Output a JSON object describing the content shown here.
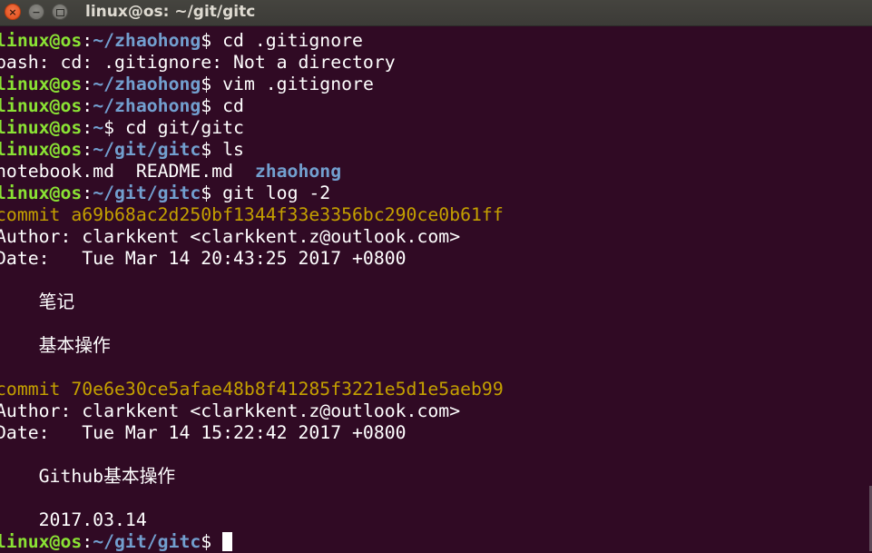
{
  "window": {
    "title": "linux@os: ~/git/gitc",
    "close_icon": "×",
    "minimize_icon": "−"
  },
  "terminal": {
    "lines": [
      {
        "type": "prompt",
        "user": "linux@os",
        "sep": ":",
        "path": "~/zhaohong",
        "sym": "$",
        "cmd": " cd .gitignore"
      },
      {
        "type": "output",
        "text": "bash: cd: .gitignore: Not a directory"
      },
      {
        "type": "prompt",
        "user": "linux@os",
        "sep": ":",
        "path": "~/zhaohong",
        "sym": "$",
        "cmd": " vim .gitignore"
      },
      {
        "type": "prompt",
        "user": "linux@os",
        "sep": ":",
        "path": "~/zhaohong",
        "sym": "$",
        "cmd": " cd"
      },
      {
        "type": "prompt",
        "user": "linux@os",
        "sep": ":",
        "path": "~",
        "sym": "$",
        "cmd": " cd git/gitc"
      },
      {
        "type": "prompt",
        "user": "linux@os",
        "sep": ":",
        "path": "~/git/gitc",
        "sym": "$",
        "cmd": " ls"
      },
      {
        "type": "ls",
        "files": "notebook.md  README.md  ",
        "dir": "zhaohong"
      },
      {
        "type": "prompt",
        "user": "linux@os",
        "sep": ":",
        "path": "~/git/gitc",
        "sym": "$",
        "cmd": " git log -2"
      },
      {
        "type": "commit",
        "text": "commit a69b68ac2d250bf1344f33e3356bc290ce0b61ff"
      },
      {
        "type": "output",
        "text": "Author: clarkkent <clarkkent.z@outlook.com>"
      },
      {
        "type": "output",
        "text": "Date:   Tue Mar 14 20:43:25 2017 +0800"
      },
      {
        "type": "output",
        "text": ""
      },
      {
        "type": "output",
        "text": "    笔记"
      },
      {
        "type": "output",
        "text": ""
      },
      {
        "type": "output",
        "text": "    基本操作"
      },
      {
        "type": "output",
        "text": ""
      },
      {
        "type": "commit",
        "text": "commit 70e6e30ce5afae48b8f41285f3221e5d1e5aeb99"
      },
      {
        "type": "output",
        "text": "Author: clarkkent <clarkkent.z@outlook.com>"
      },
      {
        "type": "output",
        "text": "Date:   Tue Mar 14 15:22:42 2017 +0800"
      },
      {
        "type": "output",
        "text": ""
      },
      {
        "type": "output",
        "text": "    Github基本操作"
      },
      {
        "type": "output",
        "text": ""
      },
      {
        "type": "output",
        "text": "    2017.03.14"
      },
      {
        "type": "prompt",
        "user": "linux@os",
        "sep": ":",
        "path": "~/git/gitc",
        "sym": "$",
        "cmd": " ",
        "cursor": true
      }
    ]
  },
  "colors": {
    "background": "#300a24",
    "prompt_user": "#8ae234",
    "prompt_path": "#729fcf",
    "commit": "#c4a000",
    "directory": "#729fcf",
    "text": "#ffffff"
  }
}
